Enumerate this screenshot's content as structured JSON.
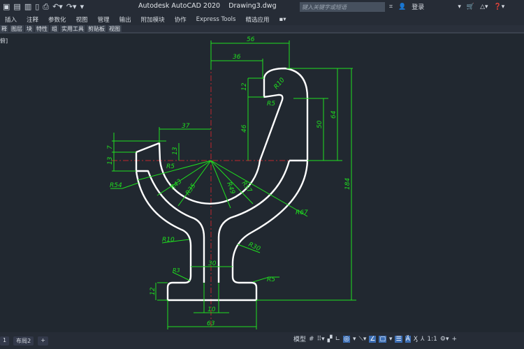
{
  "window": {
    "app_title": "Autodesk AutoCAD 2020",
    "file_name": "Drawing3.dwg"
  },
  "quick_access": [
    "save-icon",
    "save-as-icon",
    "plot-preview-icon",
    "publish-icon",
    "print-icon",
    "undo-icon",
    "redo-icon",
    "customize-icon"
  ],
  "search": {
    "placeholder": "键入关键字或短语"
  },
  "account": {
    "login_label": "登录"
  },
  "menu": [
    "插入",
    "注释",
    "参数化",
    "视图",
    "管理",
    "输出",
    "附加模块",
    "协作",
    "Express Tools",
    "精选应用"
  ],
  "ribbon_panels": [
    "释",
    "图层",
    "块",
    "特性",
    "组",
    "实用工具",
    "剪贴板",
    "视图"
  ],
  "viewport_label": "俯]",
  "dimensions": {
    "d56": "56",
    "d36": "36",
    "d12": "12",
    "r10": "R10",
    "r5a": "R5",
    "d46": "46",
    "d50": "50",
    "d64": "64",
    "d184": "184",
    "d37": "37",
    "d7": "7",
    "d13a": "13",
    "d13b": "13",
    "r5b": "R5",
    "r54": "R54",
    "r43": "R43",
    "r35": "R35",
    "r49": "R49",
    "r57": "R57",
    "r67": "R67",
    "r10b": "R10",
    "r30": "R30",
    "d30": "30",
    "r3": "R3",
    "r5c": "R5",
    "d12b": "12",
    "d10": "10",
    "d63": "63"
  },
  "colors": {
    "dimension": "#1fe01f",
    "outline": "#ffffff",
    "centerline": "#c0262b",
    "background": "#212830"
  },
  "layout_tabs": [
    "1",
    "布局2",
    "+"
  ],
  "status": {
    "model_label": "模型",
    "scale_label": "1:1"
  }
}
